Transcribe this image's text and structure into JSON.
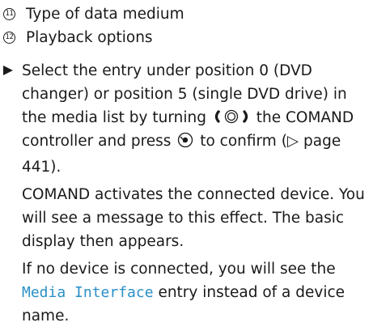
{
  "legend": [
    {
      "number": "11",
      "text": "Type of data medium"
    },
    {
      "number": "12",
      "text": "Playback options"
    }
  ],
  "step": {
    "line1_a": "Select the entry under position 0 (DVD changer) or position 5 (single DVD drive) in the media list by turning ",
    "line1_b": " the COMAND controller and press ",
    "line1_c": " to confirm (",
    "page_ref_arrow": "▷",
    "page_ref": " page 441).",
    "para2": "COMAND activates the connected device. You will see a message to this effect. The basic display then appears.",
    "para3_a": "If no device is connected, you will see the ",
    "para3_highlight": "Media Interface",
    "para3_b": " entry instead of a device name."
  },
  "icons": {
    "bullet": "triangle-bullet-icon",
    "controller_turn": "controller-turn-icon",
    "controller_press": "controller-press-icon"
  },
  "colors": {
    "text": "#1a1a1a",
    "highlight": "#2a8fc7"
  }
}
